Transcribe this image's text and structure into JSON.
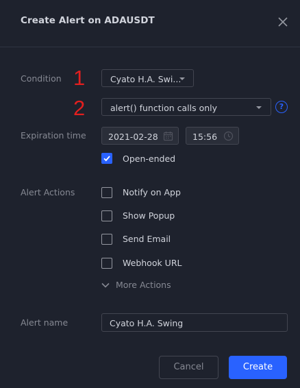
{
  "dialog": {
    "title": "Create Alert on ADAUSDT"
  },
  "annotations": {
    "marker_1": "1",
    "marker_2": "2"
  },
  "condition": {
    "label": "Condition",
    "indicator_value": "Cyato H.A. Swi...",
    "trigger_value": "alert() function calls only",
    "help_symbol": "?"
  },
  "expiration": {
    "label": "Expiration time",
    "date_value": "2021-02-28",
    "time_value": "15:56",
    "open_ended_label": "Open-ended",
    "open_ended_checked": true
  },
  "actions": {
    "label": "Alert Actions",
    "items": [
      {
        "label": "Notify on App",
        "checked": false
      },
      {
        "label": "Show Popup",
        "checked": false
      },
      {
        "label": "Send Email",
        "checked": false
      },
      {
        "label": "Webhook URL",
        "checked": false
      }
    ],
    "more_label": "More Actions"
  },
  "alert_name": {
    "label": "Alert name",
    "value": "Cyato H.A. Swing"
  },
  "footer": {
    "cancel_label": "Cancel",
    "create_label": "Create"
  },
  "colors": {
    "background": "#1e222d",
    "accent": "#2962ff",
    "annotation": "#e31f1f",
    "muted_text": "#868993",
    "text": "#d1d4dc"
  }
}
